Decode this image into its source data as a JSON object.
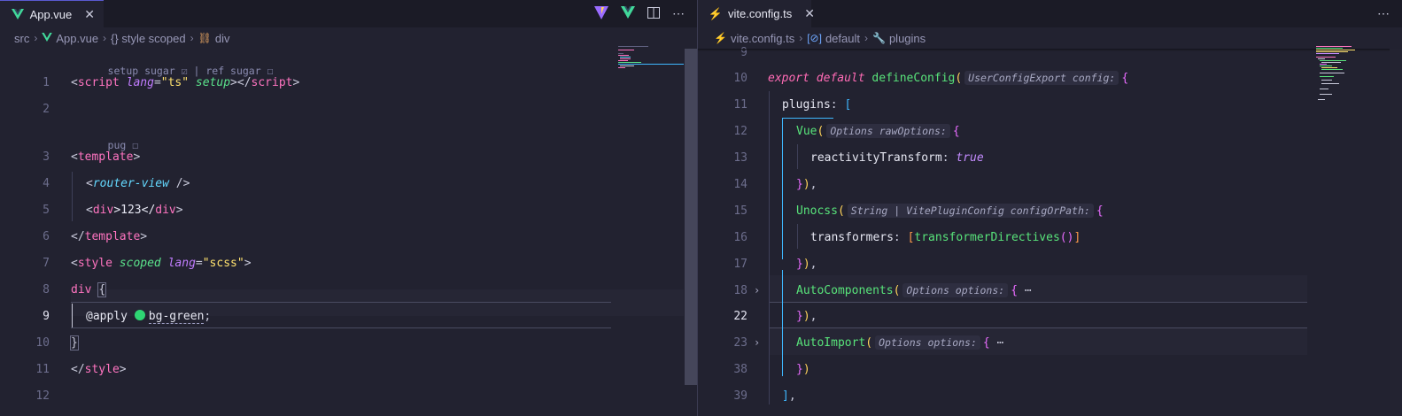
{
  "left": {
    "tab": {
      "icon": "vue-icon",
      "label": "App.vue",
      "close": "✕"
    },
    "actions": [
      "vite-icon",
      "vue-devtools-icon",
      "split-editor-icon",
      "more-icon"
    ],
    "breadcrumb": [
      "src",
      "App.vue",
      "{} style scoped",
      "div"
    ],
    "lens_top": {
      "a": "setup sugar ☑",
      "sep": " | ",
      "b": "ref sugar ☐"
    },
    "lens_pug": "pug ☐",
    "line_numbers": [
      "1",
      "2",
      "3",
      "4",
      "5",
      "6",
      "7",
      "8",
      "9",
      "10",
      "11",
      "12"
    ],
    "code": {
      "l1": {
        "open": "<",
        "tag": "script",
        "sp": " ",
        "attr1": "lang",
        "eq": "=",
        "val1": "\"ts\"",
        "sp2": " ",
        "attr2": "setup",
        "mid": "></",
        "tag2": "script",
        "close": ">"
      },
      "l3": {
        "open": "<",
        "tag": "template",
        "close": ">"
      },
      "l4": {
        "open": "<",
        "comp": "router-view",
        "close": " />"
      },
      "l5": {
        "open": "<",
        "tag": "div",
        "mid": ">123</",
        "tag2": "div",
        "close": ">"
      },
      "l6": {
        "open": "</",
        "tag": "template",
        "close": ">"
      },
      "l7": {
        "open": "<",
        "tag": "style",
        "sp": " ",
        "attr1": "scoped",
        "sp2": " ",
        "attr2": "lang",
        "eq": "=",
        "val": "\"scss\"",
        "close": ">"
      },
      "l8": {
        "sel": "div",
        "sp": " ",
        "brace": "{"
      },
      "l9": {
        "at": "@apply",
        "sp": " ",
        "cls": "bg-green",
        "semi": ";"
      },
      "l10": {
        "brace": "}"
      },
      "l11": {
        "open": "</",
        "tag": "style",
        "close": ">"
      }
    }
  },
  "right": {
    "tab": {
      "icon": "lightning-icon",
      "label": "vite.config.ts",
      "close": "✕"
    },
    "actions": [
      "more-icon"
    ],
    "breadcrumb": [
      "vite.config.ts",
      "default",
      "plugins"
    ],
    "line_numbers": [
      "9",
      "10",
      "11",
      "12",
      "13",
      "14",
      "15",
      "16",
      "17",
      "18",
      "22",
      "23",
      "38",
      "39"
    ],
    "code": {
      "l10": {
        "k1": "export",
        "k2": "default",
        "fn": "defineConfig",
        "paren": "(",
        "hint": "UserConfigExport config:",
        "brace": "{"
      },
      "l11": {
        "prop": "plugins",
        "colon": ": ",
        "br": "["
      },
      "l12": {
        "fn": "Vue",
        "paren": "(",
        "hint": "Options rawOptions:",
        "brace": "{"
      },
      "l13": {
        "prop": "reactivityTransform",
        "colon": ": ",
        "val": "true"
      },
      "l14": {
        "brace": "}",
        "paren": ")",
        "comma": ","
      },
      "l15": {
        "fn": "Unocss",
        "paren": "(",
        "hint": "String | VitePluginConfig configOrPath:",
        "brace": "{"
      },
      "l16": {
        "prop": "transformers",
        "colon": ": ",
        "br": "[",
        "fn": "transformerDirectives",
        "call": "()",
        "br2": "]"
      },
      "l17": {
        "brace": "}",
        "paren": ")",
        "comma": ","
      },
      "l18": {
        "fn": "AutoComponents",
        "paren": "(",
        "hint": "Options options:",
        "brace": "{",
        "ellipsis": "⋯"
      },
      "l22": {
        "brace": "}",
        "paren": ")",
        "comma": ","
      },
      "l23": {
        "fn": "AutoImport",
        "paren": "(",
        "hint": "Options options:",
        "brace": "{",
        "ellipsis": "⋯"
      },
      "l38": {
        "brace": "}",
        "paren": ")"
      },
      "l39": {
        "br": "]",
        "comma": ","
      }
    }
  },
  "colors": {
    "background": "#222230",
    "accent": "#5a5ad0",
    "string": "#ffe26e",
    "tag": "#ff74c0",
    "function": "#58e37a"
  }
}
